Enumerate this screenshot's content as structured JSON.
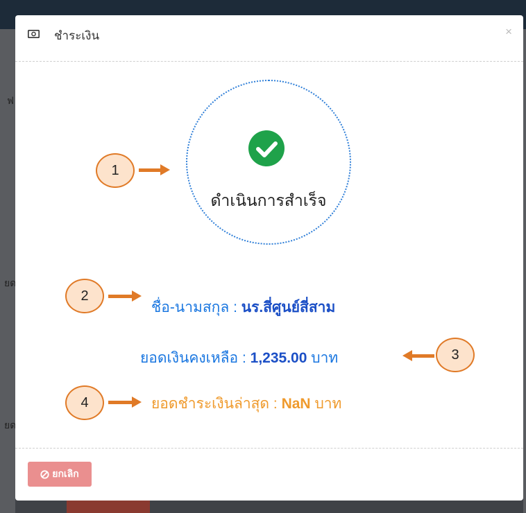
{
  "modal": {
    "title": "ชำระเงิน",
    "close_label": "×",
    "status": "ดำเนินการสำเร็จ",
    "name_label": "ชื่อ-นามสกุล :",
    "name_value": "นร.สี่ศูนย์สี่สาม",
    "balance_label": "ยอดเงินคงเหลือ :",
    "balance_value": "1,235.00",
    "balance_unit": "บาท",
    "latest_payment_label": "ยอดชำระเงินล่าสุด :",
    "latest_payment_value": "NaN",
    "latest_payment_unit": "บาท",
    "cancel_label": "ยกเลิก"
  },
  "callouts": [
    "1",
    "2",
    "3",
    "4"
  ],
  "icons": {
    "title_icon": "money-bill-icon",
    "status_icon": "check-circle-icon",
    "cancel_icon": "ban-icon"
  },
  "background": {
    "text_1": "ฟ",
    "text_2": "ยด",
    "text_3": "ยด"
  },
  "colors": {
    "accent_blue": "#1976e0",
    "value_blue": "#1b4fc6",
    "accent_orange": "#ef9a2c",
    "success_green": "#1fa24a",
    "cancel_red": "#ea8f8f",
    "callout_border": "#e07a27"
  }
}
